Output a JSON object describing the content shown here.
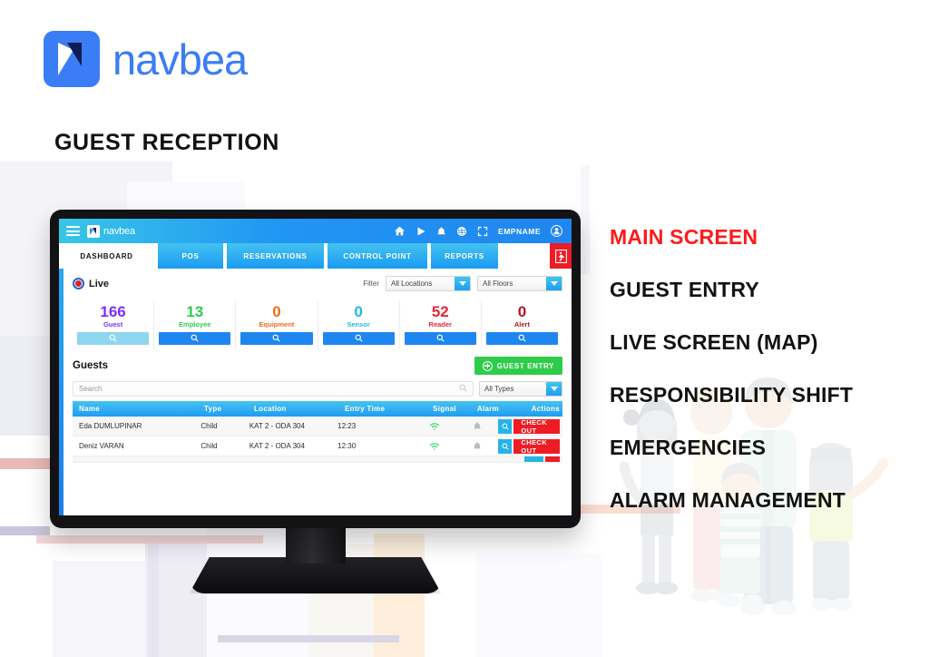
{
  "brand": {
    "name": "navbea",
    "logo_icon": "navbea-arrow-logo",
    "color": "#3b7df4"
  },
  "page_title": "GUEST RECEPTION",
  "feature_list": [
    {
      "label": "MAIN SCREEN",
      "color": "#ff1a1a"
    },
    {
      "label": "GUEST ENTRY",
      "color": "#121212"
    },
    {
      "label": "LIVE SCREEN (MAP)",
      "color": "#121212"
    },
    {
      "label": "RESPONSIBILITY SHIFT",
      "color": "#121212"
    },
    {
      "label": "EMERGENCIES",
      "color": "#121212"
    },
    {
      "label": "ALARM MANAGEMENT",
      "color": "#121212"
    }
  ],
  "app": {
    "topbar": {
      "menu_icon": "hamburger-icon",
      "logo_text": "navbea",
      "icons": [
        "home-icon",
        "play-icon",
        "bell-icon",
        "globe-icon",
        "fullscreen-icon"
      ],
      "employee_name": "EMPNAME",
      "avatar_icon": "user-avatar-icon"
    },
    "tabs": [
      {
        "label": "DASHBOARD",
        "active": true
      },
      {
        "label": "POS",
        "active": false
      },
      {
        "label": "RESERVATIONS",
        "active": false
      },
      {
        "label": "CONTROL POINT",
        "active": false
      },
      {
        "label": "REPORTS",
        "active": false
      }
    ],
    "emergency_button": {
      "icon": "emergency-exit-icon",
      "color": "#ee1c24"
    },
    "live": {
      "label": "Live",
      "indicator_color": "#e02020"
    },
    "filter": {
      "label": "Filter",
      "location_select": "All Locations",
      "floor_select": "All Floors"
    },
    "stats": [
      {
        "value": "166",
        "label": "Guest",
        "color": "#7b2ff7",
        "button_icon": "search-icon",
        "button_active": true
      },
      {
        "value": "13",
        "label": "Employee",
        "color": "#2ecc4a",
        "button_icon": "search-icon",
        "button_active": false
      },
      {
        "value": "0",
        "label": "Equipment",
        "color": "#ef6c1a",
        "button_icon": "search-icon",
        "button_active": false
      },
      {
        "value": "0",
        "label": "Sensor",
        "color": "#22b8e0",
        "button_icon": "search-icon",
        "button_active": false
      },
      {
        "value": "52",
        "label": "Reader",
        "color": "#e8243a",
        "button_icon": "search-icon",
        "button_active": false
      },
      {
        "value": "0",
        "label": "Alert",
        "color": "#b3151f",
        "button_icon": "search-icon",
        "button_active": false
      }
    ],
    "guests_section": {
      "title": "Guests",
      "guest_entry_button": "GUEST ENTRY",
      "search_placeholder": "Search",
      "search_value": "",
      "type_select": "All Types",
      "columns": [
        "Name",
        "Type",
        "Location",
        "Entry Time",
        "Signal",
        "Alarm",
        "Actions"
      ],
      "rows": [
        {
          "name": "Eda DUMLUPINAR",
          "type": "Child",
          "location": "KAT 2 - ODA 304",
          "entry_time": "12:23",
          "signal": "wifi-icon",
          "alarm": "bell-icon",
          "action_search": "search-icon",
          "action_checkout": "CHECK OUT"
        },
        {
          "name": "Deniz VARAN",
          "type": "Child",
          "location": "KAT 2 - ODA 304",
          "entry_time": "12:30",
          "signal": "wifi-icon",
          "alarm": "bell-icon",
          "action_search": "search-icon",
          "action_checkout": "CHECK OUT"
        }
      ]
    }
  }
}
